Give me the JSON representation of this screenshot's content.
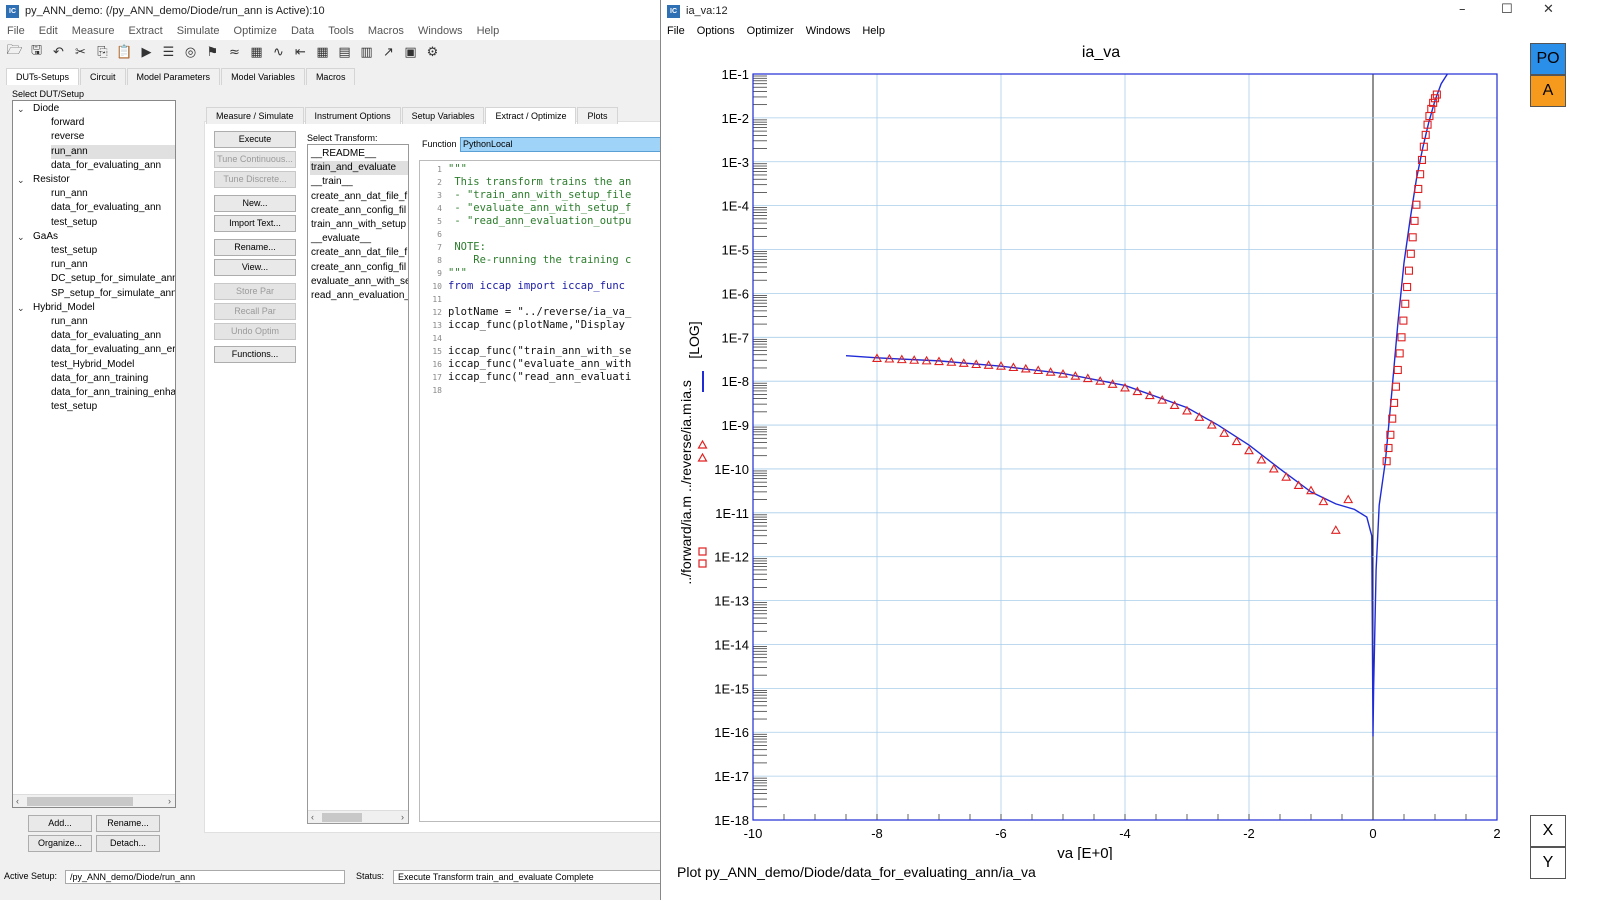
{
  "main_window": {
    "title": "py_ANN_demo: (/py_ANN_demo/Diode/run_ann is Active):10",
    "menu": [
      "File",
      "Edit",
      "Measure",
      "Extract",
      "Simulate",
      "Optimize",
      "Data",
      "Tools",
      "Macros",
      "Windows",
      "Help"
    ],
    "toolbar_icons": [
      "open-icon",
      "save-icon",
      "undo-icon",
      "cut-icon",
      "copy-icon",
      "paste-icon",
      "run-icon",
      "list-icon",
      "target-icon",
      "pin-icon",
      "plot-icon",
      "calc-icon",
      "curve-icon",
      "arrow-left-icon",
      "grid-icon",
      "grid-edit-icon",
      "grid-delete-icon",
      "chart-up-icon",
      "window-icon",
      "gear-icon"
    ],
    "top_tabs": [
      "DUTs-Setups",
      "Circuit",
      "Model Parameters",
      "Model Variables",
      "Macros"
    ],
    "select_label": "Select DUT/Setup",
    "tree": [
      {
        "label": "Diode",
        "level": 0,
        "expanded": true
      },
      {
        "label": "forward",
        "level": 1
      },
      {
        "label": "reverse",
        "level": 1
      },
      {
        "label": "run_ann",
        "level": 1,
        "selected": true
      },
      {
        "label": "data_for_evaluating_ann",
        "level": 1
      },
      {
        "label": "Resistor",
        "level": 0,
        "expanded": true
      },
      {
        "label": "run_ann",
        "level": 1
      },
      {
        "label": "data_for_evaluating_ann",
        "level": 1
      },
      {
        "label": "test_setup",
        "level": 1
      },
      {
        "label": "GaAs",
        "level": 0,
        "expanded": true
      },
      {
        "label": "test_setup",
        "level": 1
      },
      {
        "label": "run_ann",
        "level": 1
      },
      {
        "label": "DC_setup_for_simulate_ann",
        "level": 1
      },
      {
        "label": "SP_setup_for_simulate_ann",
        "level": 1
      },
      {
        "label": "Hybrid_Model",
        "level": 0,
        "expanded": true
      },
      {
        "label": "run_ann",
        "level": 1
      },
      {
        "label": "data_for_evaluating_ann",
        "level": 1
      },
      {
        "label": "data_for_evaluating_ann_er",
        "level": 1
      },
      {
        "label": "test_Hybrid_Model",
        "level": 1
      },
      {
        "label": "data_for_ann_training",
        "level": 1
      },
      {
        "label": "data_for_ann_training_enha",
        "level": 1
      },
      {
        "label": "test_setup",
        "level": 1
      }
    ],
    "tree_buttons": {
      "add": "Add...",
      "rename": "Rename...",
      "organize": "Organize...",
      "detach": "Detach..."
    },
    "inner_tabs": [
      "Measure / Simulate",
      "Instrument Options",
      "Setup Variables",
      "Extract / Optimize",
      "Plots"
    ],
    "action_buttons": [
      {
        "label": "Execute",
        "enabled": true
      },
      {
        "label": "Tune Continuous...",
        "enabled": false
      },
      {
        "label": "Tune Discrete...",
        "enabled": false
      },
      {
        "label": "New...",
        "enabled": true
      },
      {
        "label": "Import Text...",
        "enabled": true
      },
      {
        "label": "Rename...",
        "enabled": true
      },
      {
        "label": "View...",
        "enabled": true
      },
      {
        "label": "Store Par",
        "enabled": false
      },
      {
        "label": "Recall Par",
        "enabled": false
      },
      {
        "label": "Undo Optim",
        "enabled": false
      },
      {
        "label": "Functions...",
        "enabled": true
      }
    ],
    "transform_label": "Select Transform:",
    "transforms": [
      "__README__",
      "train_and_evaluate",
      "__train__",
      "create_ann_dat_file_f",
      "create_ann_config_fil",
      "train_ann_with_setup",
      "__evaluate__",
      "create_ann_dat_file_f",
      "create_ann_config_fil",
      "evaluate_ann_with_se",
      "read_ann_evaluation_"
    ],
    "selected_transform": 1,
    "function_label": "Function",
    "function_value": "PythonLocal",
    "code_lines": [
      {
        "n": "1",
        "text": "\"\"\"",
        "kind": "str"
      },
      {
        "n": "2",
        "text": " This transform trains the an",
        "kind": "str"
      },
      {
        "n": "3",
        "text": " - \"train_ann_with_setup_file",
        "kind": "str"
      },
      {
        "n": "4",
        "text": " - \"evaluate_ann_with_setup_f",
        "kind": "str"
      },
      {
        "n": "5",
        "text": " - \"read_ann_evaluation_outpu",
        "kind": "str"
      },
      {
        "n": "6",
        "text": "",
        "kind": "str"
      },
      {
        "n": "7",
        "text": " NOTE:",
        "kind": "str"
      },
      {
        "n": "8",
        "text": "    Re-running the training c",
        "kind": "str"
      },
      {
        "n": "9",
        "text": "\"\"\"",
        "kind": "str"
      },
      {
        "n": "10",
        "text": "from iccap import iccap_func",
        "kind": "import"
      },
      {
        "n": "11",
        "text": "",
        "kind": "txt"
      },
      {
        "n": "12",
        "text": "plotName = \"../reverse/ia_va_",
        "kind": "txt"
      },
      {
        "n": "13",
        "text": "iccap_func(plotName,\"Display",
        "kind": "txt"
      },
      {
        "n": "14",
        "text": "",
        "kind": "txt"
      },
      {
        "n": "15",
        "text": "iccap_func(\"train_ann_with_se",
        "kind": "txt"
      },
      {
        "n": "16",
        "text": "iccap_func(\"evaluate_ann_with",
        "kind": "txt"
      },
      {
        "n": "17",
        "text": "iccap_func(\"read_ann_evaluati",
        "kind": "txt"
      },
      {
        "n": "18",
        "text": "",
        "kind": "txt"
      }
    ],
    "status": {
      "active_setup_label": "Active Setup:",
      "active_setup_value": "/py_ANN_demo/Diode/run_ann",
      "status_label": "Status:",
      "status_value": "Execute Transform train_and_evaluate Complete"
    }
  },
  "plot_window": {
    "title": "ia_va:12",
    "menu": [
      "File",
      "Options",
      "Optimizer",
      "Windows",
      "Help"
    ],
    "footer": "Plot py_ANN_demo/Diode/data_for_evaluating_ann/ia_va",
    "side_buttons": {
      "po": "PO",
      "a": "A",
      "x": "X",
      "y": "Y"
    },
    "colors": {
      "sim_line": "#1f2bd6",
      "meas_marker": "#e02020",
      "po_button": "#2a8fe8",
      "a_button": "#f59a1c",
      "grid": "#a9cdea"
    }
  },
  "chart_data": {
    "type": "scatter",
    "title": "ia_va",
    "xlabel": "va  [E+0]",
    "ylabel_parts": [
      "../forward/ia.m  ../reverse/ia.m",
      "ia.s",
      "[LOG]"
    ],
    "xlim": [
      -10,
      2
    ],
    "ylim": [
      1e-18,
      0.1
    ],
    "y_scale": "log",
    "grid": true,
    "x_ticks": [
      "-10",
      "-8",
      "-6",
      "-4",
      "-2",
      "0",
      "2"
    ],
    "y_ticks": [
      "1E-18",
      "1E-17",
      "1E-16",
      "1E-15",
      "1E-14",
      "1E-13",
      "1E-12",
      "1E-11",
      "1E-10",
      "1E-9",
      "1E-8",
      "1E-7",
      "1E-6",
      "1E-5",
      "1E-4",
      "1E-3",
      "1E-2",
      "1E-1"
    ],
    "legend_markers": [
      {
        "label": "../forward/ia.m",
        "marker": "square"
      },
      {
        "label": "../reverse/ia.m",
        "marker": "triangle"
      },
      {
        "label": "ia.s",
        "marker": "line"
      }
    ],
    "series": [
      {
        "name": "ia.s",
        "style": "line",
        "x": [
          -8.5,
          -8,
          -7,
          -6,
          -5,
          -4,
          -3,
          -2.5,
          -2,
          -1.5,
          -1,
          -0.6,
          -0.3,
          -0.1,
          -0.02,
          0,
          0.01,
          0.05,
          0.1,
          0.2,
          0.3,
          0.4,
          0.5,
          0.6,
          0.7,
          0.8,
          0.9,
          1.0,
          1.1,
          1.2
        ],
        "y": [
          3.8e-08,
          3.4e-08,
          2.9e-08,
          2.2e-08,
          1.5e-08,
          8e-09,
          2.5e-09,
          1e-09,
          3.5e-10,
          1e-10,
          3e-11,
          1.6e-11,
          1.2e-11,
          8e-12,
          3e-12,
          8e-17,
          1e-15,
          5e-13,
          1.5e-11,
          1.5e-10,
          5e-09,
          2e-07,
          5e-06,
          5e-05,
          0.0004,
          0.002,
          0.008,
          0.025,
          0.06,
          0.1
        ]
      },
      {
        "name": "../reverse/ia.m",
        "style": "triangle",
        "x": [
          -8,
          -7.8,
          -7.6,
          -7.4,
          -7.2,
          -7.0,
          -6.8,
          -6.6,
          -6.4,
          -6.2,
          -6.0,
          -5.8,
          -5.6,
          -5.4,
          -5.2,
          -5.0,
          -4.8,
          -4.6,
          -4.4,
          -4.2,
          -4.0,
          -3.8,
          -3.6,
          -3.4,
          -3.2,
          -3.0,
          -2.8,
          -2.6,
          -2.4,
          -2.2,
          -2.0,
          -1.8,
          -1.6,
          -1.4,
          -1.2,
          -1.0,
          -0.8,
          -0.6,
          -0.4
        ],
        "y": [
          3.3e-08,
          3.2e-08,
          3.1e-08,
          3e-08,
          2.9e-08,
          2.8e-08,
          2.7e-08,
          2.55e-08,
          2.4e-08,
          2.3e-08,
          2.2e-08,
          2.05e-08,
          1.9e-08,
          1.75e-08,
          1.6e-08,
          1.45e-08,
          1.3e-08,
          1.15e-08,
          1e-08,
          8.5e-09,
          7e-09,
          5.8e-09,
          4.7e-09,
          3.7e-09,
          2.8e-09,
          2.1e-09,
          1.5e-09,
          1e-09,
          6.5e-10,
          4.2e-10,
          2.6e-10,
          1.6e-10,
          1e-10,
          6.5e-11,
          4.2e-11,
          3.2e-11,
          1.8e-11,
          4e-12,
          2e-11
        ]
      },
      {
        "name": "../forward/ia.m",
        "style": "square",
        "x": [
          0.22,
          0.25,
          0.28,
          0.31,
          0.34,
          0.37,
          0.4,
          0.43,
          0.46,
          0.49,
          0.52,
          0.55,
          0.58,
          0.61,
          0.64,
          0.67,
          0.7,
          0.73,
          0.76,
          0.79,
          0.82,
          0.85,
          0.88,
          0.91,
          0.94,
          0.97,
          1.0,
          1.03
        ],
        "y": [
          1.5e-10,
          3e-10,
          6e-10,
          1.4e-09,
          3.2e-09,
          7.5e-09,
          1.8e-08,
          4.3e-08,
          1e-07,
          2.4e-07,
          5.8e-07,
          1.4e-06,
          3.3e-06,
          8e-06,
          1.9e-05,
          4.5e-05,
          0.000105,
          0.00024,
          0.00052,
          0.0011,
          0.0022,
          0.0041,
          0.007,
          0.011,
          0.016,
          0.022,
          0.028,
          0.034
        ]
      }
    ]
  }
}
